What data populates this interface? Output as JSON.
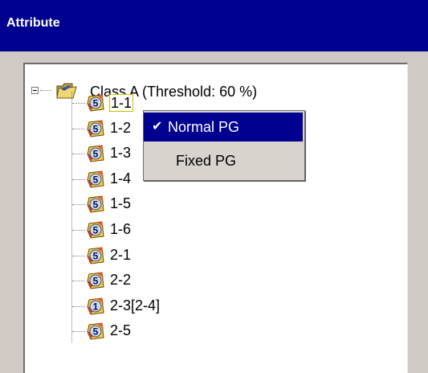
{
  "title": "Attribute",
  "tree": {
    "root": {
      "label": "Class A (Threshold: 60 %)"
    },
    "children": [
      {
        "label": "1-1",
        "badge": "5",
        "selected": true
      },
      {
        "label": "1-2",
        "badge": "5"
      },
      {
        "label": "1-3",
        "badge": "5"
      },
      {
        "label": "1-4",
        "badge": "5"
      },
      {
        "label": "1-5",
        "badge": "5"
      },
      {
        "label": "1-6",
        "badge": "5"
      },
      {
        "label": "2-1",
        "badge": "5"
      },
      {
        "label": "2-2",
        "badge": "5"
      },
      {
        "label": "2-3[2-4]",
        "badge": "1"
      },
      {
        "label": "2-5",
        "badge": "5"
      }
    ]
  },
  "context_menu": {
    "items": [
      {
        "label": "Normal PG",
        "checked": true,
        "check_mark": "✔"
      },
      {
        "label": "Fixed PG",
        "checked": false
      }
    ]
  },
  "colors": {
    "title_bg": "#000090",
    "highlight": "#000090"
  }
}
